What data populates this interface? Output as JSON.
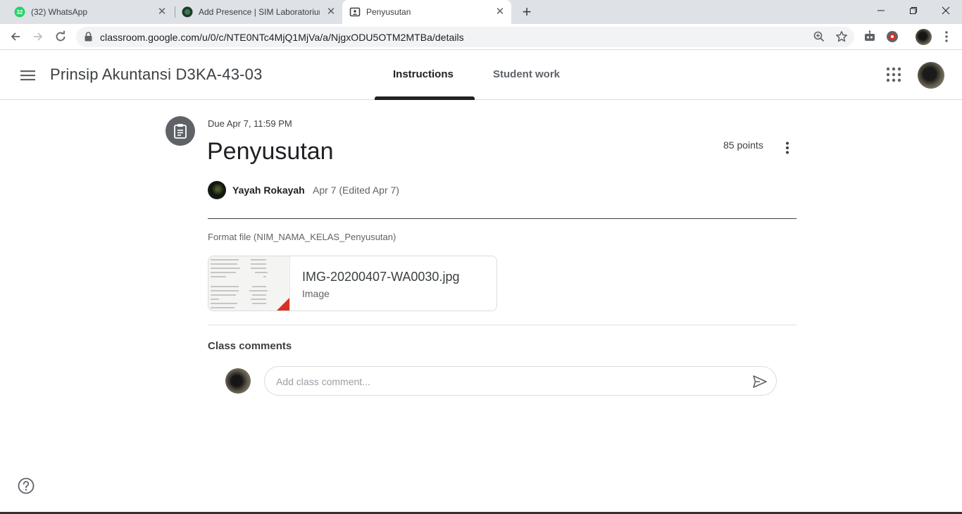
{
  "browser": {
    "tabs": [
      {
        "title": "(32) WhatsApp",
        "badge": "32",
        "favicon": "whatsapp-icon"
      },
      {
        "title": "Add Presence | SIM Laboratorium",
        "favicon": "globe-icon"
      },
      {
        "title": "Penyusutan",
        "favicon": "classroom-icon",
        "active": true
      }
    ],
    "url": "classroom.google.com/u/0/c/NTE0NTc4MjQ1MjVa/a/NjgxODU5OTM2MTBa/details"
  },
  "header": {
    "course_title": "Prinsip Akuntansi D3KA-43-03",
    "tabs": [
      {
        "label": "Instructions",
        "active": true
      },
      {
        "label": "Student work",
        "active": false
      }
    ]
  },
  "assignment": {
    "due": "Due Apr 7, 11:59 PM",
    "title": "Penyusutan",
    "points": "85 points",
    "author": "Yayah Rokayah",
    "posted": "Apr 7 (Edited Apr 7)",
    "description": "Format file (NIM_NAMA_KELAS_Penyusutan)",
    "attachment": {
      "name": "IMG-20200407-WA0030.jpg",
      "type": "Image"
    }
  },
  "comments": {
    "title": "Class comments",
    "placeholder": "Add class comment..."
  },
  "colors": {
    "accent": "#202124",
    "attachment_corner": "#d93025",
    "whatsapp": "#25d366"
  }
}
